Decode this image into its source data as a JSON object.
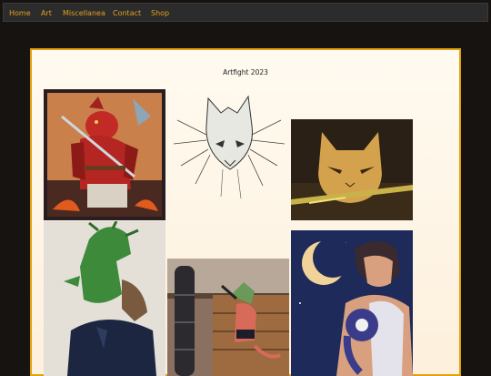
{
  "nav": {
    "items": [
      {
        "label": "Home"
      },
      {
        "label": "Art"
      },
      {
        "label": "Miscellanea"
      },
      {
        "label": "Contact"
      },
      {
        "label": "Shop"
      }
    ]
  },
  "gallery": {
    "title": "Artfight 2023"
  },
  "colors": {
    "page_background": "#171310",
    "nav_background": "#2c2c2c",
    "nav_link": "#e0a020",
    "panel_border": "#e3a10c",
    "panel_background": "#fff8ec"
  }
}
